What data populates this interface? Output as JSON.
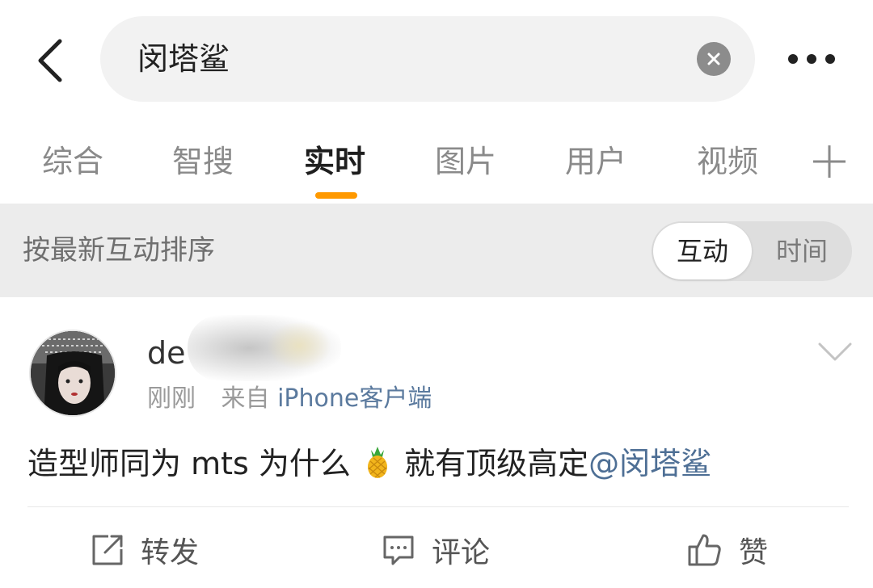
{
  "header": {
    "search_query": "闵塔鲨"
  },
  "tabs": [
    {
      "label": "综合",
      "active": false
    },
    {
      "label": "智搜",
      "active": false
    },
    {
      "label": "实时",
      "active": true
    },
    {
      "label": "图片",
      "active": false
    },
    {
      "label": "用户",
      "active": false
    },
    {
      "label": "视频",
      "active": false
    }
  ],
  "sort_bar": {
    "label": "按最新互动排序",
    "options": [
      {
        "label": "互动",
        "selected": true
      },
      {
        "label": "时间",
        "selected": false
      }
    ]
  },
  "post": {
    "username": "de",
    "time": "刚刚",
    "source_prefix": "来自",
    "source": "iPhone客户端",
    "text_before": "造型师同为 mts 为什么",
    "emoji": "pineapple-icon",
    "text_after": "就有顶级高定",
    "mention": "@闵塔鲨",
    "actions": {
      "repost": "转发",
      "comment": "评论",
      "like": "赞"
    }
  },
  "colors": {
    "accent": "#ff9900",
    "link": "#4e6f95",
    "sort_bar_bg": "#ececec"
  }
}
